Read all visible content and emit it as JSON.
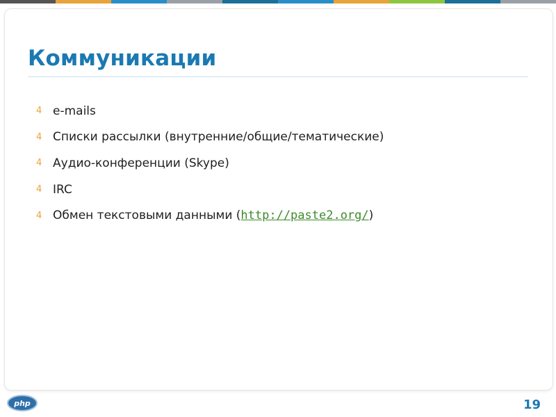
{
  "colors": {
    "accent": "#1b79b2",
    "bullet": "#e8a33a",
    "link": "#3d8a2a",
    "topbar": [
      "#555555",
      "#e8a33a",
      "#2a8ec9",
      "#9aa0a6",
      "#1b6f99",
      "#2a8ec9",
      "#e8a33a",
      "#8dc63f",
      "#1b6f99",
      "#9aa0a6"
    ]
  },
  "slide": {
    "title": "Коммуникации",
    "bullet_icon": "arrow-bullet-icon",
    "bullets": [
      {
        "text": "e-mails"
      },
      {
        "text": "Списки рассылки (внутренние/общие/тематические)"
      },
      {
        "text": "Аудио-конференции (Skype)"
      },
      {
        "text": "IRC"
      },
      {
        "text": "Обмен текстовыми данными (",
        "link": "http://paste2.org/",
        "suffix": ")"
      }
    ],
    "bullet_glyph": "4",
    "logo_text": "php",
    "page_number": "19"
  }
}
